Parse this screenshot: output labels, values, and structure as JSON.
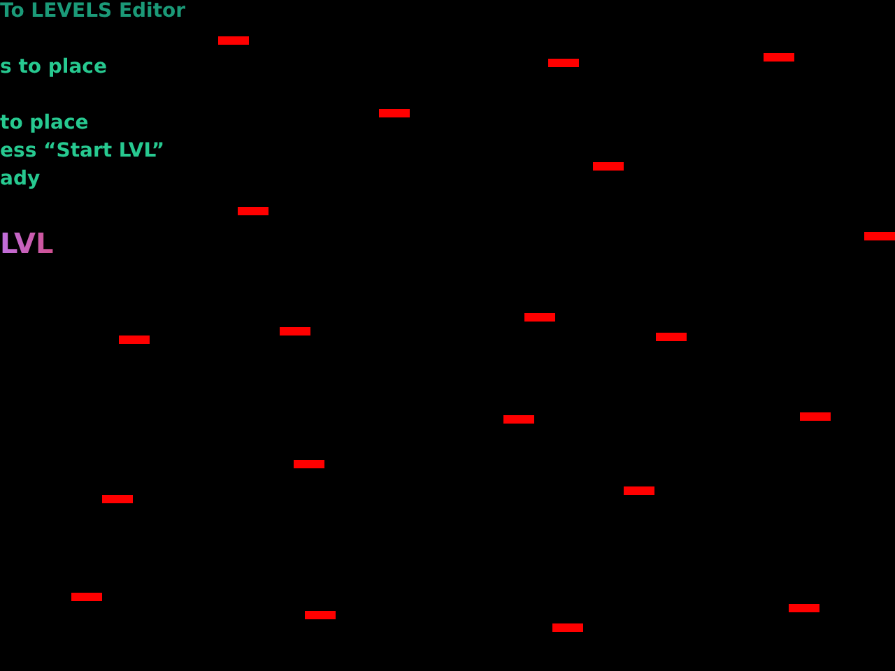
{
  "hud": {
    "title": "To LEVELS Editor",
    "lines": [
      "s to place",
      "to place",
      "ess “Start LVL”",
      "ady"
    ],
    "level_label": "LVL"
  }
}
